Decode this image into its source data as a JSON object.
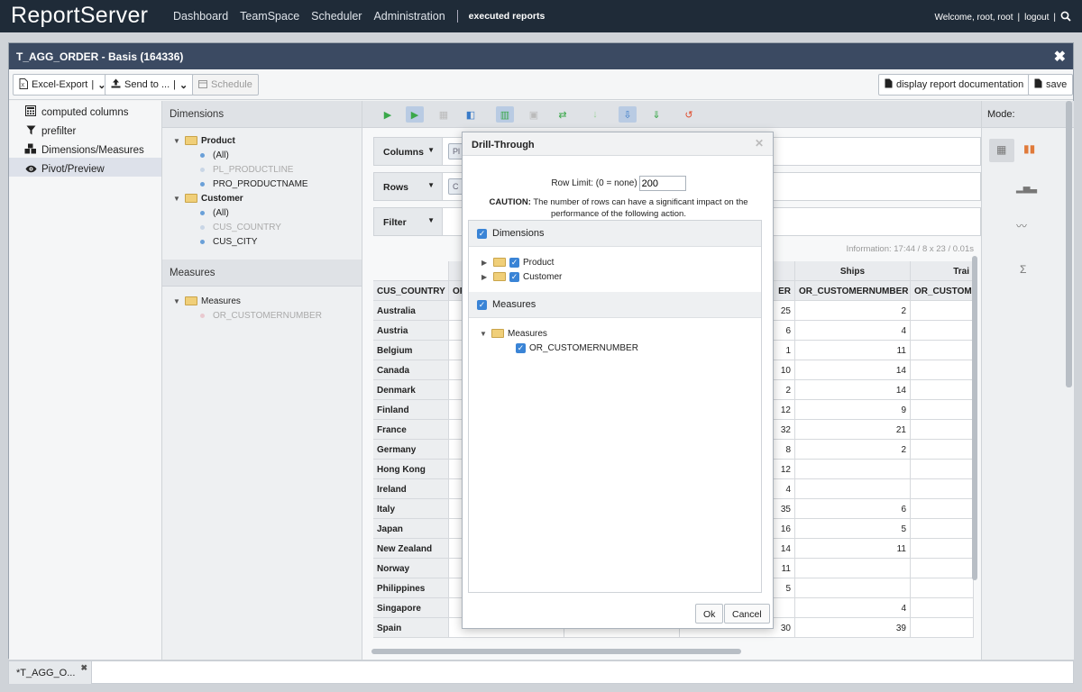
{
  "topnav": {
    "logo": "ReportServer",
    "links": [
      "Dashboard",
      "TeamSpace",
      "Scheduler",
      "Administration"
    ],
    "executed": "executed reports",
    "welcome": "Welcome, root, root",
    "logout": "logout"
  },
  "window": {
    "title": "T_AGG_ORDER - Basis (164336)"
  },
  "toolbar": {
    "excel_export": "Excel-Export",
    "send_to": "Send to ...",
    "schedule": "Schedule",
    "documentation": "display report documentation",
    "save": "save"
  },
  "leftnav": {
    "items": [
      "computed columns",
      "prefilter",
      "Dimensions/Measures",
      "Pivot/Preview"
    ]
  },
  "dimensions": {
    "header": "Dimensions",
    "product": "Product",
    "product_items": [
      "(All)",
      "PL_PRODUCTLINE",
      "PRO_PRODUCTNAME"
    ],
    "customer": "Customer",
    "customer_items": [
      "(All)",
      "CUS_COUNTRY",
      "CUS_CITY"
    ]
  },
  "measures": {
    "header": "Measures",
    "folder": "Measures",
    "item": "OR_CUSTOMERNUMBER"
  },
  "pivot": {
    "columns_label": "Columns",
    "rows_label": "Rows",
    "filter_label": "Filter",
    "col_chip": "Pl",
    "row_chip": "C",
    "information": "Information:  17:44  /  8 x 23  /  0.01s",
    "row_header": "CUS_COUNTRY",
    "col_header_left": "OF",
    "col_header_mid": "ER",
    "col_group_ships": "Ships",
    "col_group_trains": "Trai",
    "col_header_ships": "OR_CUSTOMERNUMBER",
    "col_header_trains": "OR_CUSTOM",
    "rows": [
      {
        "country": "Australia",
        "v1": "25",
        "v2": "2"
      },
      {
        "country": "Austria",
        "v1": "6",
        "v2": "4"
      },
      {
        "country": "Belgium",
        "v1": "1",
        "v2": "11"
      },
      {
        "country": "Canada",
        "v1": "10",
        "v2": "14"
      },
      {
        "country": "Denmark",
        "v1": "2",
        "v2": "14"
      },
      {
        "country": "Finland",
        "v1": "12",
        "v2": "9"
      },
      {
        "country": "France",
        "v1": "32",
        "v2": "21"
      },
      {
        "country": "Germany",
        "v1": "8",
        "v2": "2"
      },
      {
        "country": "Hong Kong",
        "v1": "12",
        "v2": ""
      },
      {
        "country": "Ireland",
        "v1": "4",
        "v2": ""
      },
      {
        "country": "Italy",
        "v1": "35",
        "v2": "6"
      },
      {
        "country": "Japan",
        "v1": "16",
        "v2": "5"
      },
      {
        "country": "New Zealand",
        "v1": "14",
        "v2": "11"
      },
      {
        "country": "Norway",
        "v1": "11",
        "v2": ""
      },
      {
        "country": "Philippines",
        "v1": "5",
        "v2": ""
      },
      {
        "country": "Singapore",
        "v1": "",
        "v2": "4"
      },
      {
        "country": "Spain",
        "v1": "30",
        "v2": "39"
      }
    ]
  },
  "mode": {
    "header": "Mode:",
    "sum_symbol": "Σ"
  },
  "dialog": {
    "title": "Drill-Through",
    "row_limit_label": "Row Limit: (0 = none)",
    "row_limit_value": "200",
    "caution_bold": "CAUTION:",
    "caution_text": " The number of rows can have a significant impact on the performance of the following action.",
    "dimensions_label": "Dimensions",
    "dim_items": [
      "Product",
      "Customer"
    ],
    "measures_label": "Measures",
    "meas_folder": "Measures",
    "meas_item": "OR_CUSTOMERNUMBER",
    "ok": "Ok",
    "cancel": "Cancel"
  },
  "tabs": {
    "active": "*T_AGG_O..."
  }
}
